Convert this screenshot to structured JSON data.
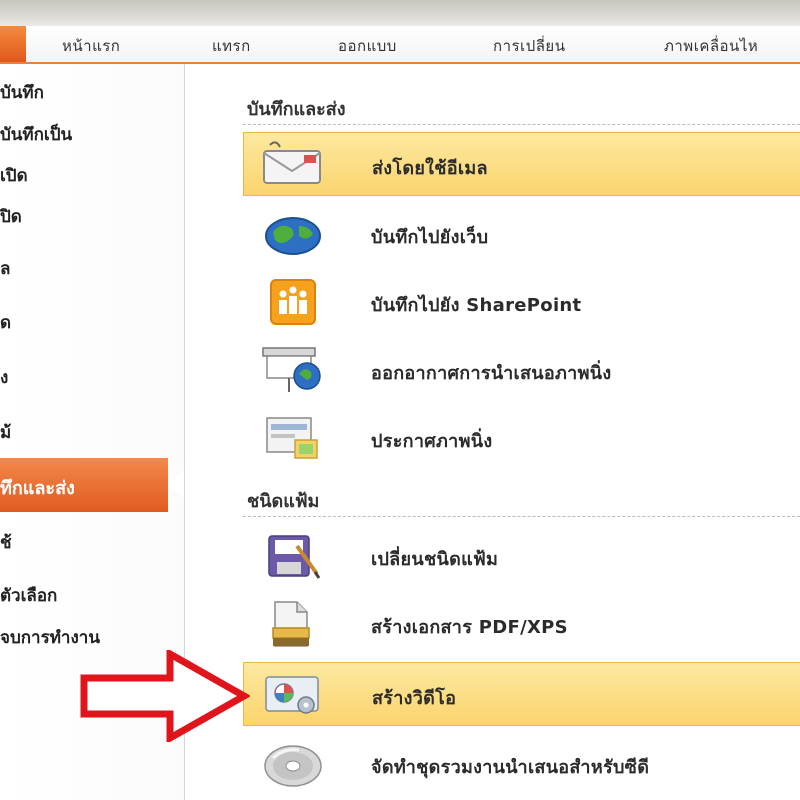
{
  "ribbon": {
    "tabs": [
      "หน้าแรก",
      "แทรก",
      "ออกแบบ",
      "การเปลี่ยน",
      "ภาพเคลื่อนไห"
    ]
  },
  "backstage": {
    "left_items": [
      "บันทึก",
      "บันทึกเป็น",
      "เปิด",
      "ปิด",
      "ล",
      "ด",
      "ง",
      "ม้"
    ],
    "selected_item": "ทึกและส่ง",
    "left_items_below": [
      "ช้",
      "ตัวเลือก",
      "จบการทำงาน"
    ]
  },
  "panel": {
    "section1_title": "บันทึกและส่ง",
    "section1_options": [
      {
        "label": "ส่งโดยใช้อีเมล",
        "icon": "email-icon",
        "highlighted": true
      },
      {
        "label": "บันทึกไปยังเว็บ",
        "icon": "globe-icon",
        "highlighted": false
      },
      {
        "label": "บันทึกไปยัง SharePoint",
        "icon": "sharepoint-icon",
        "highlighted": false
      },
      {
        "label": "ออกอากาศการนำเสนอภาพนิ่ง",
        "icon": "broadcast-icon",
        "highlighted": false
      },
      {
        "label": "ประกาศภาพนิ่ง",
        "icon": "publish-slides-icon",
        "highlighted": false
      }
    ],
    "section2_title": "ชนิดแฟ้ม",
    "section2_options": [
      {
        "label": "เปลี่ยนชนิดแฟ้ม",
        "icon": "change-filetype-icon",
        "highlighted": false
      },
      {
        "label": "สร้างเอกสาร PDF/XPS",
        "icon": "pdf-xps-icon",
        "highlighted": false
      },
      {
        "label": "สร้างวิดีโอ",
        "icon": "video-icon",
        "highlighted": true
      },
      {
        "label": "จัดทำชุดรวมงานนำเสนอสำหรับซีดี",
        "icon": "cd-icon",
        "highlighted": false
      }
    ]
  },
  "colors": {
    "accent_orange": "#e15b21",
    "highlight_yellow": "#fbd46e",
    "annotation_red": "#e0141b"
  }
}
